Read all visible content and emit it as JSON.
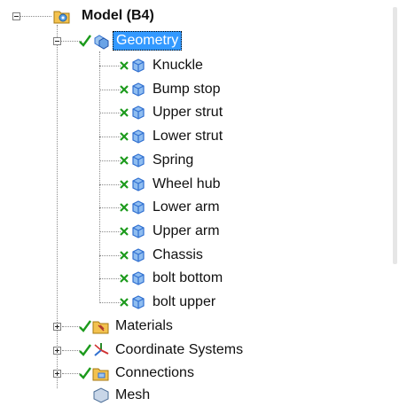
{
  "tree": {
    "model": {
      "label": "Model (B4)",
      "icon": "model-folder-icon"
    },
    "geometry": {
      "label": "Geometry",
      "icon": "geometry-cubes-icon",
      "status_icon": "green-check-icon",
      "bodies": [
        "Knuckle",
        "Bump stop",
        "Upper strut",
        "Lower strut",
        "Spring",
        "Wheel hub",
        "Lower arm",
        "Upper arm",
        "Chassis",
        "bolt bottom",
        "bolt upper"
      ],
      "body_icon": "body-cube-icon",
      "body_status_icon": "green-x-icon"
    },
    "materials": {
      "label": "Materials",
      "icon": "materials-folder-icon"
    },
    "coordinate_systems": {
      "label": "Coordinate Systems",
      "icon": "coordinate-axes-icon"
    },
    "connections": {
      "label": "Connections",
      "icon": "connections-folder-icon"
    },
    "mesh": {
      "label": "Mesh",
      "icon": "mesh-icon"
    }
  },
  "colors": {
    "selection": "#3399ff",
    "check_green": "#1c9a1c",
    "body_blue": "#2f6fd0"
  }
}
